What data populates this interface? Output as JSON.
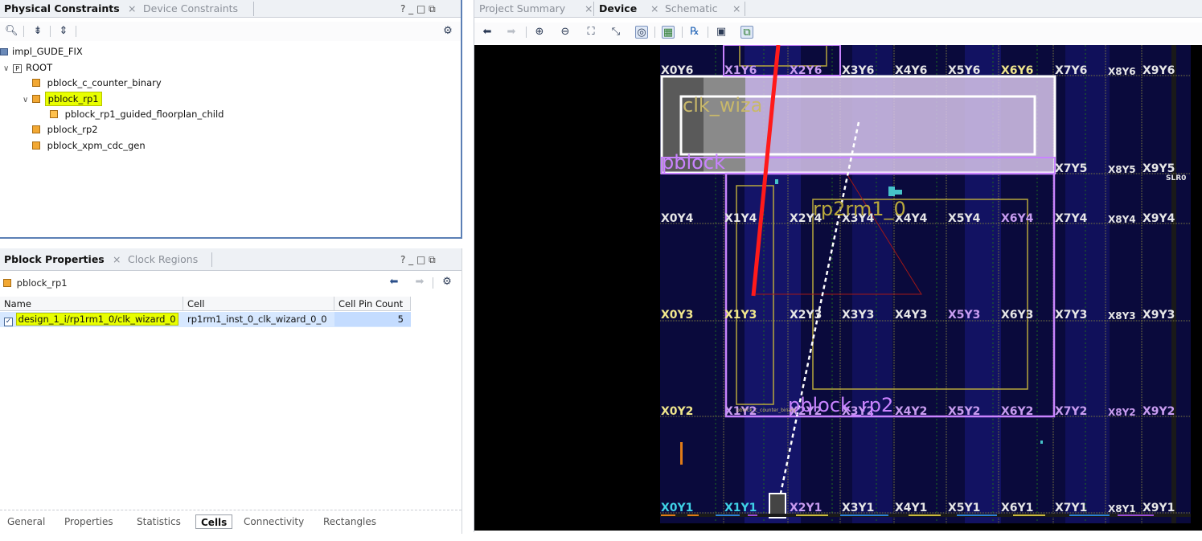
{
  "physical_constraints": {
    "tabs": [
      {
        "label": "Physical Constraints",
        "active": true
      },
      {
        "label": "Device Constraints",
        "active": false
      }
    ],
    "window_controls": "? _ □ ⧉",
    "tree": {
      "root_impl": "impl_GUDE_FIX",
      "root": "ROOT",
      "items": [
        {
          "label": "pblock_c_counter_binary"
        },
        {
          "label": "pblock_rp1",
          "selected": true
        },
        {
          "label": "pblock_rp1_guided_floorplan_child"
        },
        {
          "label": "pblock_rp2"
        },
        {
          "label": "pblock_xpm_cdc_gen"
        }
      ]
    }
  },
  "pblock_properties": {
    "tabs": [
      {
        "label": "Pblock Properties",
        "active": true
      },
      {
        "label": "Clock Regions",
        "active": false
      }
    ],
    "window_controls": "? _ □ ⧉",
    "selected_pblock": "pblock_rp1",
    "table": {
      "columns": [
        "Name",
        "Cell",
        "Cell Pin Count"
      ],
      "rows": [
        {
          "name": "design_1_i/rp1rm1_0/clk_wizard_0",
          "cell": "rp1rm1_inst_0_clk_wizard_0_0",
          "pin_count": "5",
          "checked": true
        }
      ]
    },
    "bottom_tabs": [
      "General",
      "Properties",
      "Statistics",
      "Cells",
      "Connectivity",
      "Rectangles"
    ],
    "active_bottom_tab": "Cells"
  },
  "device_panel": {
    "tabs": [
      {
        "label": "Project Summary",
        "active": false
      },
      {
        "label": "Device",
        "active": true
      },
      {
        "label": "Schematic",
        "active": false
      }
    ],
    "clock_region_labels": {
      "row6": [
        "X0Y6",
        "X1Y6",
        "X2Y6",
        "X3Y6",
        "X4Y6",
        "X5Y6",
        "X6Y6",
        "X7Y6",
        "X8Y6",
        "X9Y6"
      ],
      "row5": [
        "X7Y5",
        "X8Y5",
        "X9Y5"
      ],
      "row4": [
        "X0Y4",
        "X1Y4",
        "X2Y4",
        "X3Y4",
        "X4Y4",
        "X5Y4",
        "X6Y4",
        "X7Y4",
        "X8Y4",
        "X9Y4"
      ],
      "row3": [
        "X0Y3",
        "X1Y3",
        "X2Y3",
        "X3Y3",
        "X4Y3",
        "X5Y3",
        "X6Y3",
        "X7Y3",
        "X8Y3",
        "X9Y3"
      ],
      "row2": [
        "X0Y2",
        "X1Y2",
        "X2Y2",
        "X3Y2",
        "X4Y2",
        "X5Y2",
        "X6Y2",
        "X7Y2",
        "X8Y2",
        "X9Y2"
      ],
      "row1": [
        "X0Y1",
        "X1Y1",
        "X2Y1",
        "X3Y1",
        "X4Y1",
        "X5Y1",
        "X6Y1",
        "X7Y1",
        "X8Y1",
        "X9Y1"
      ]
    },
    "overlay_labels": {
      "clk_wizard": "clk_wiza",
      "pblock_top": "pblock",
      "rp2rm1": "rp2rm1_0",
      "pblock_rp2": "pblock_rp2",
      "slr": "SLR0",
      "counter_binary": "pblock_c_counter_binary"
    }
  }
}
